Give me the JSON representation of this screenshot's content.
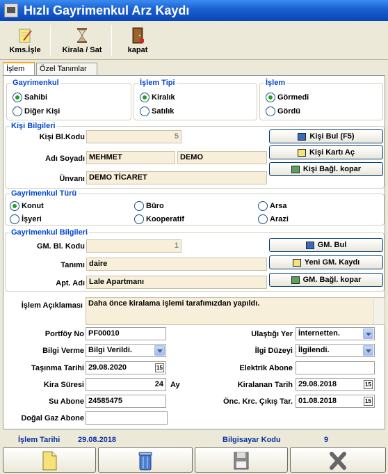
{
  "window": {
    "title": "Hızlı Gayrimenkul Arz Kaydı"
  },
  "toolbar": {
    "kms_isle": "Kms.İşle",
    "kirala_sat": "Kirala / Sat",
    "kapat": "kapat"
  },
  "tabs": [
    "İşlem",
    "Özel Tanımlar"
  ],
  "gayrimenkul": {
    "title": "Gayrimenkul",
    "sahibi": "Sahibi",
    "diger_kisi": "Diğer Kişi"
  },
  "islem_tipi": {
    "title": "İşlem Tipi",
    "kiralik": "Kiralık",
    "satilik": "Satılık"
  },
  "islem": {
    "title": "İşlem",
    "gormedi": "Görmedi",
    "gordu": "Gördü"
  },
  "kisi": {
    "title": "Kişi Bilgileri",
    "kod_label": "Kişi Bl.Kodu",
    "kod_value": "5",
    "adsoyad_label": "Adı Soyadı",
    "ad_value": "MEHMET",
    "soyad_value": "DEMO",
    "unvan_label": "Ünvanı",
    "unvan_value": "DEMO TİCARET",
    "btn_bul": "Kişi Bul (F5)",
    "btn_kart": "Kişi Kartı Aç",
    "btn_kopar": "Kişi Bağl. kopar"
  },
  "tur": {
    "title": "Gayrimenkul Türü",
    "konut": "Konut",
    "buro": "Büro",
    "arsa": "Arsa",
    "isyeri": "İşyeri",
    "kooperatif": "Kooperatif",
    "arazi": "Arazi"
  },
  "gm": {
    "title": "Gayrimenkul Bilgileri",
    "kod_label": "GM. Bl. Kodu",
    "kod_value": "1",
    "tanim_label": "Tanımı",
    "tanim_value": "daire",
    "apt_label": "Apt. Adı",
    "apt_value": "Lale Apartmanı",
    "btn_bul": "GM. Bul",
    "btn_yeni": "Yeni GM. Kaydı",
    "btn_kopar": "GM. Bağl. kopar"
  },
  "aciklama": {
    "label": "İşlem Açıklaması",
    "value": "Daha önce kiralama işlemi tarafımızdan yapıldı."
  },
  "form": {
    "portfoy_label": "Portföy No",
    "portfoy_value": "PF00010",
    "bilgi_label": "Bilgi Verme",
    "bilgi_value": "Bilgi Verildi.",
    "tasinma_label": "Taşınma Tarihi",
    "tasinma_value": "29.08.2020",
    "kira_label": "Kira Süresi",
    "kira_value": "24",
    "kira_unit": "Ay",
    "su_label": "Su Abone",
    "su_value": "24585475",
    "dogalgaz_label": "Doğal Gaz Abone",
    "dogalgaz_value": "",
    "ulastigi_label": "Ulaştığı Yer",
    "ulastigi_value": "İnternetten.",
    "ilgi_label": "İlgi Düzeyi",
    "ilgi_value": "İlgilendi.",
    "elektrik_label": "Elektrik Abone",
    "elektrik_value": "",
    "kiralanan_label": "Kiralanan Tarih",
    "kiralanan_value": "29.08.2018",
    "cikis_label": "Önc. Krc. Çıkış Tar.",
    "cikis_value": "01.08.2018"
  },
  "status": {
    "islem_tarihi_label": "İşlem Tarihi",
    "islem_tarihi_value": "29.08.2018",
    "bilgisayar_label": "Bilgisayar Kodu",
    "bilgisayar_value": "9"
  },
  "icons": {
    "title": "window-app-icon",
    "kms": "note-pencil-icon",
    "kirala": "hourglass-icon",
    "kapat": "door-exit-icon",
    "bottom": [
      "new-document-icon",
      "trash-icon",
      "save-disk-icon",
      "close-x-icon"
    ]
  },
  "colors": {
    "accent": "#0046d5",
    "title_bar": "#0a46b8",
    "readonly_field": "#f7efd9",
    "radio_on": "#21a121"
  }
}
